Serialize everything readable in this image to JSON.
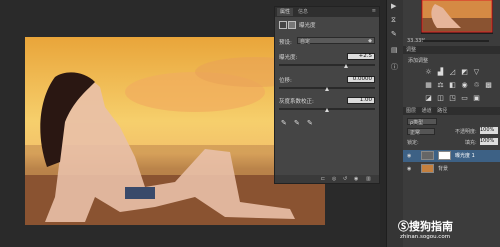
{
  "properties_panel": {
    "tabs": [
      "属性",
      "信息"
    ],
    "title": "曝光度",
    "preset_label": "预设:",
    "preset_value": "自定",
    "exposure_label": "曝光度:",
    "exposure_value": "+2.5",
    "exposure_level": 0.7,
    "offset_label": "位移:",
    "offset_value": "0.0000",
    "offset_level": 0.5,
    "gamma_label": "灰度系数校正:",
    "gamma_value": "1.00",
    "gamma_level": 0.5
  },
  "navigator": {
    "zoom": "33.33%"
  },
  "adjustments_panel": {
    "tab": "调整",
    "subtitle": "添加调整"
  },
  "layers_panel": {
    "tabs": [
      "图层",
      "通道",
      "路径"
    ],
    "kind_filter": "ρ类型",
    "blend_mode": "正常",
    "opacity_label": "不透明度:",
    "opacity_value": "100%",
    "fill_label": "填充:",
    "fill_value": "100%",
    "lock_label": "锁定:",
    "layers": [
      {
        "name": "曝光度 1"
      },
      {
        "name": "背景"
      }
    ]
  },
  "watermark": {
    "brand": "搜狗指南",
    "url": "zhinan.sogou.com"
  },
  "colors": {
    "panel_bg": "#454545",
    "dock_bg": "#3c3c3c",
    "selected_layer": "#3d6185"
  }
}
